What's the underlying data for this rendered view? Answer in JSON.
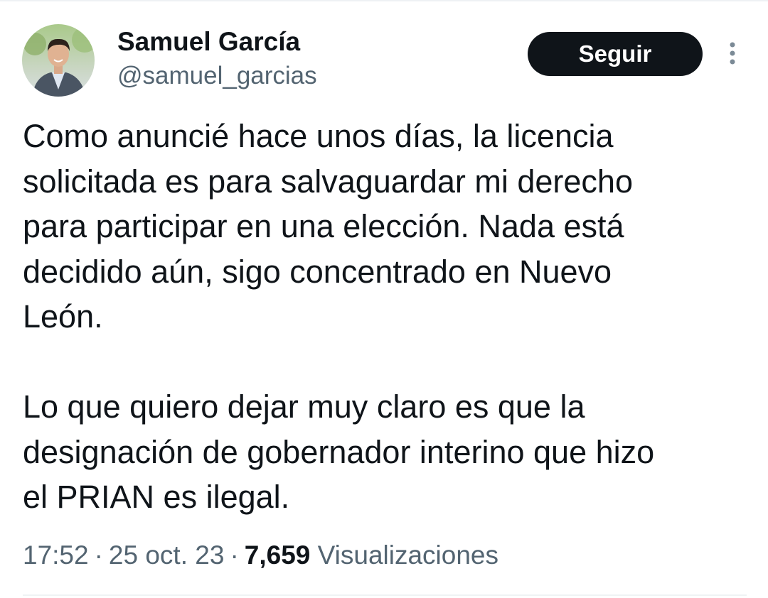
{
  "tweet": {
    "author": {
      "display_name": "Samuel García",
      "handle": "@samuel_garcias",
      "avatar_icon": "profile-photo"
    },
    "follow_button_label": "Seguir",
    "more_icon": "more-vertical-icon",
    "paragraphs": [
      "Como anuncié hace unos días, la licencia\nsolicitada es para salvaguardar mi derecho\npara participar en una elección. Nada está\ndecidido aún, sigo concentrado en Nuevo\nLeón.",
      "Lo que quiero dejar muy claro es que la\ndesignación de gobernador interino que hizo\nel PRIAN es ilegal."
    ],
    "meta": {
      "time": "17:52",
      "separator": "·",
      "date": "25 oct. 23",
      "views_count": "7,659",
      "views_label": "Visualizaciones"
    }
  },
  "colors": {
    "text_primary": "#0f1419",
    "text_secondary": "#536471",
    "button_bg": "#0f1419",
    "button_text": "#ffffff",
    "divider": "#eff3f4"
  }
}
